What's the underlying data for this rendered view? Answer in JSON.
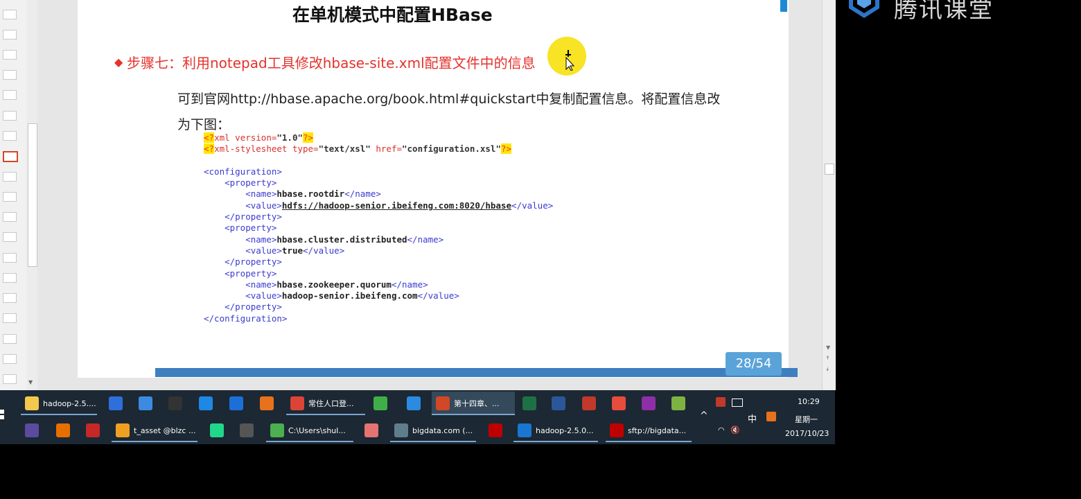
{
  "slide": {
    "title": "在单机模式中配置HBase",
    "step": "步骤七：利用notepad工具修改hbase-site.xml配置文件中的信息",
    "desc_line1": "可到官网http://hbase.apache.org/book.html#quickstart中复制配置信息。将配置信息改",
    "desc_line2": "为下图：",
    "page_counter": "28/54",
    "code": {
      "pi1": {
        "open": "<?",
        "name": "xml version=",
        "value": "\"1.0\"",
        "close": "?>"
      },
      "pi2": {
        "open": "<?",
        "name": "xml-stylesheet type=",
        "type_value": "\"text/xsl\"",
        "href": " href=",
        "href_value": "\"configuration.xsl\"",
        "close": "?>"
      },
      "config_open": "<configuration>",
      "config_close": "</configuration>",
      "property_open": "<property>",
      "property_close": "</property>",
      "name_open": "<name>",
      "name_close": "</name>",
      "value_open": "<value>",
      "value_close": "</value>",
      "properties": [
        {
          "name": "hbase.rootdir",
          "value": "hdfs://hadoop-senior.ibeifeng.com:8020/hbase"
        },
        {
          "name": "hbase.cluster.distributed",
          "value": "true"
        },
        {
          "name": "hbase.zookeeper.quorum",
          "value": "hadoop-senior.ibeifeng.com"
        }
      ]
    }
  },
  "watermark": {
    "text": "腾讯课堂"
  },
  "taskbar": {
    "row1": [
      {
        "name": "explorer-hadoop",
        "label": "hadoop-2.5....",
        "icon": "folder-icon",
        "color": "#f2c94c"
      },
      {
        "name": "app-g",
        "label": "",
        "icon": "g-app-icon",
        "color": "#2f6fdb"
      },
      {
        "name": "app-baidu-netdisk",
        "label": "",
        "icon": "cloud-icon",
        "color": "#3c8be0"
      },
      {
        "name": "app-qq",
        "label": "",
        "icon": "penguin-icon",
        "color": "#333333"
      },
      {
        "name": "app-kugou",
        "label": "",
        "icon": "k-app-icon",
        "color": "#1e88e5"
      },
      {
        "name": "app-ie",
        "label": "",
        "icon": "ie-icon",
        "color": "#1d6fd8"
      },
      {
        "name": "app-firefox",
        "label": "",
        "icon": "firefox-icon",
        "color": "#e8711c"
      },
      {
        "name": "app-chrome",
        "label": "常住人口登...",
        "icon": "chrome-icon",
        "color": "#db4437"
      },
      {
        "name": "app-360",
        "label": "",
        "icon": "browser-360-icon",
        "color": "#3fae49"
      },
      {
        "name": "app-feige",
        "label": "",
        "icon": "bird-icon",
        "color": "#2a8be0"
      },
      {
        "name": "app-powerpoint",
        "label": "第十四章、...",
        "icon": "powerpoint-icon",
        "color": "#d24726"
      },
      {
        "name": "app-excel",
        "label": "",
        "icon": "excel-icon",
        "color": "#1e7145"
      },
      {
        "name": "app-word",
        "label": "",
        "icon": "word-icon",
        "color": "#2b579a"
      },
      {
        "name": "app-tool",
        "label": "",
        "icon": "tool-icon",
        "color": "#c0392b"
      },
      {
        "name": "app-xmind",
        "label": "",
        "icon": "xmind-icon",
        "color": "#e74c3c"
      },
      {
        "name": "app-axure",
        "label": "",
        "icon": "axure-rp-icon",
        "color": "#8e2fa8"
      },
      {
        "name": "app-green",
        "label": "",
        "icon": "green-app-icon",
        "color": "#7cb342"
      }
    ],
    "row2": [
      {
        "name": "app-eclipse",
        "label": "",
        "icon": "eclipse-icon",
        "color": "#5b4aa0"
      },
      {
        "name": "app-java",
        "label": "",
        "icon": "java-cup-icon",
        "color": "#e76f00"
      },
      {
        "name": "app-winrar",
        "label": "",
        "icon": "books-icon",
        "color": "#c62828"
      },
      {
        "name": "app-tasset",
        "label": "t_asset @blzc ...",
        "icon": "paw-icon",
        "color": "#f0a020"
      },
      {
        "name": "app-pycharm",
        "label": "",
        "icon": "pycharm-icon",
        "color": "#21d789"
      },
      {
        "name": "app-j",
        "label": "",
        "icon": "j-app-icon",
        "color": "#555555"
      },
      {
        "name": "app-notepad",
        "label": "C:\\Users\\shul...",
        "icon": "notepad-icon",
        "color": "#4caf50"
      },
      {
        "name": "app-pencil",
        "label": "",
        "icon": "pencil-icon",
        "color": "#e57373"
      },
      {
        "name": "app-bigdata",
        "label": "bigdata.com (...",
        "icon": "terminal-icon",
        "color": "#607d8b"
      },
      {
        "name": "app-filezilla",
        "label": "",
        "icon": "filezilla-icon",
        "color": "#bf0000"
      },
      {
        "name": "app-virtualbox",
        "label": "hadoop-2.5.0...",
        "icon": "virtualbox-icon",
        "color": "#1976d2"
      },
      {
        "name": "app-sftp",
        "label": "sftp://bigdata...",
        "icon": "filezilla-icon",
        "color": "#bf0000"
      }
    ],
    "tray": {
      "ime": "中",
      "time": "10:29",
      "weekday": "星期一",
      "date": "2017/10/23",
      "expand": "^",
      "volume": "🔇"
    }
  },
  "colors": {
    "accent_red": "#e5322c",
    "slide_blue": "#3f7fc0",
    "counter_blue": "#5aa3d9",
    "taskbar": "#1c2833"
  }
}
